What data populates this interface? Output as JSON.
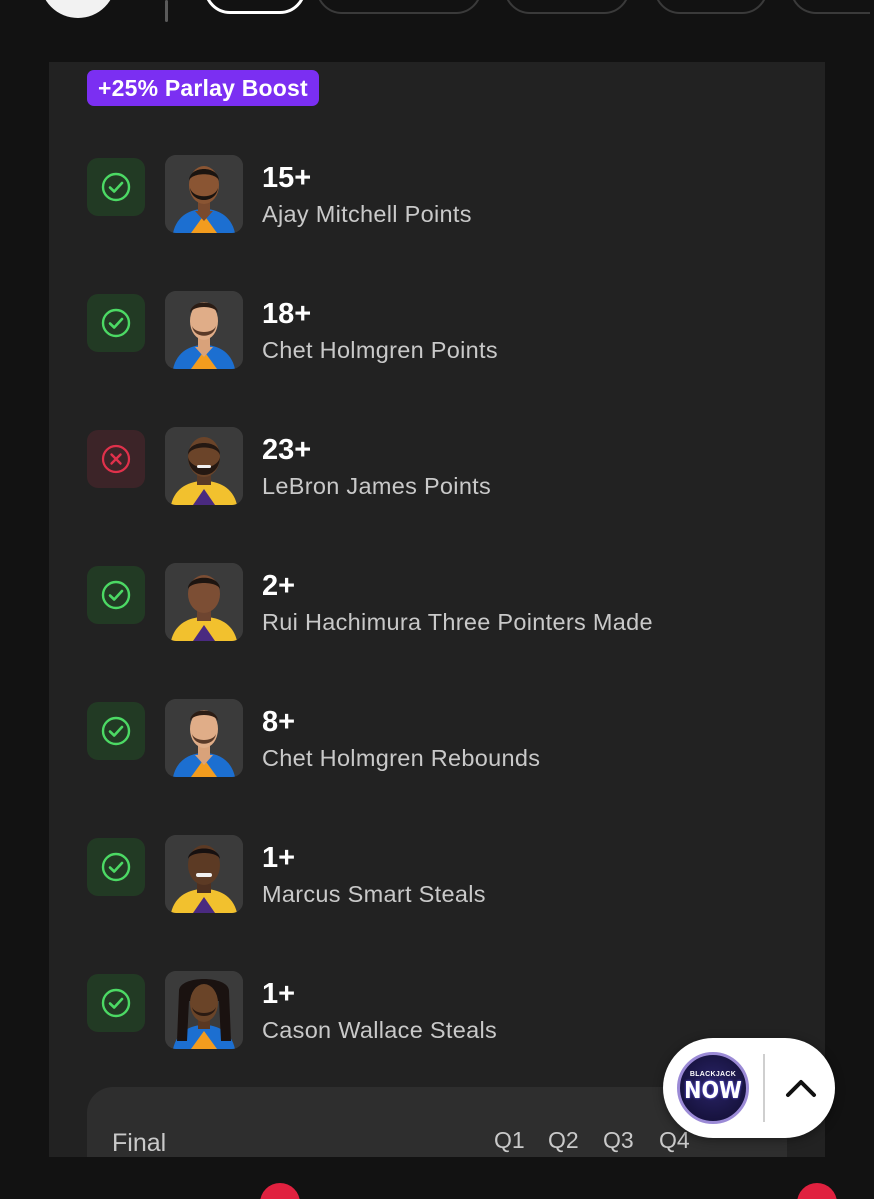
{
  "boost_label": "+25% Parlay Boost",
  "legs": [
    {
      "line": "15+",
      "desc": "Ajay Mitchell Points",
      "status": "win"
    },
    {
      "line": "18+",
      "desc": "Chet Holmgren Points",
      "status": "win"
    },
    {
      "line": "23+",
      "desc": "LeBron James Points",
      "status": "loss"
    },
    {
      "line": "2+",
      "desc": "Rui Hachimura Three Pointers Made",
      "status": "win"
    },
    {
      "line": "8+",
      "desc": "Chet Holmgren Rebounds",
      "status": "win"
    },
    {
      "line": "1+",
      "desc": "Marcus Smart Steals",
      "status": "win"
    },
    {
      "line": "1+",
      "desc": "Cason Wallace Steals",
      "status": "win"
    }
  ],
  "score": {
    "status_label": "Final",
    "quarters": [
      "Q1",
      "Q2",
      "Q3",
      "Q4"
    ]
  },
  "widget": {
    "badge_small": "BLACKJACK",
    "badge_big": "NOW",
    "icon": "chevron-up-icon"
  },
  "icons": {
    "win": "check-circle-icon",
    "loss": "x-circle-icon"
  },
  "colors": {
    "boost": "#7b2ff2",
    "win": "#4cd964",
    "loss": "#e0314b",
    "card": "#222222",
    "background": "#121212"
  }
}
